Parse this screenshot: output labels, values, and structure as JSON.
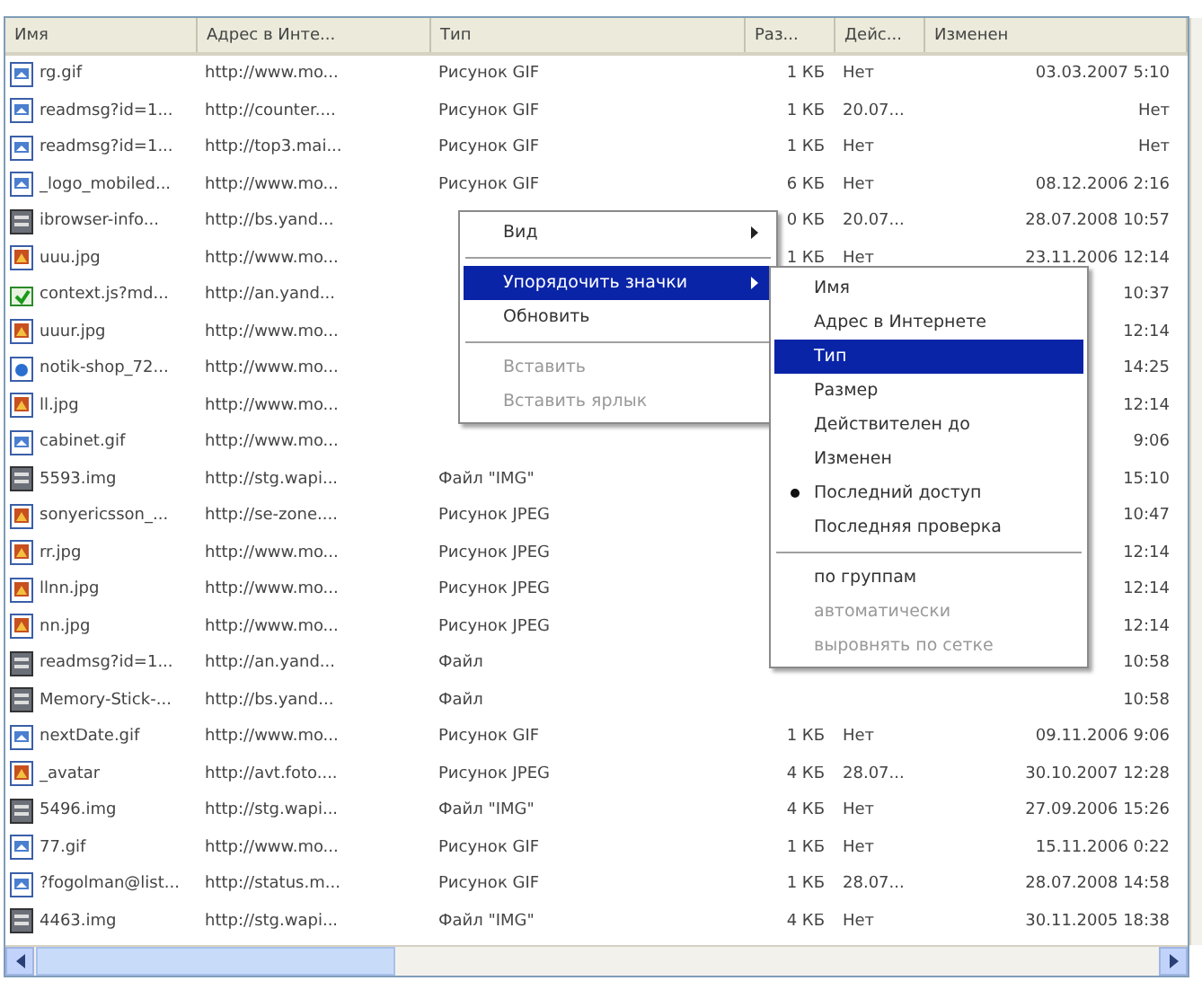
{
  "table": {
    "columns": [
      "Имя",
      "Адрес в Инте...",
      "Тип",
      "Раз...",
      "Дейс...",
      "Изменен"
    ],
    "rows": [
      {
        "kind": "gif",
        "name": "rg.gif",
        "address": "http://www.mo...",
        "type": "Рисунок GIF",
        "size": "1 КБ",
        "valid": "Нет",
        "modified": "03.03.2007 5:10"
      },
      {
        "kind": "gif",
        "name": "readmsg?id=1...",
        "address": "http://counter....",
        "type": "Рисунок GIF",
        "size": "1 КБ",
        "valid": "20.07...",
        "modified": "Нет"
      },
      {
        "kind": "gif",
        "name": "readmsg?id=1...",
        "address": "http://top3.mai...",
        "type": "Рисунок GIF",
        "size": "1 КБ",
        "valid": "Нет",
        "modified": "Нет"
      },
      {
        "kind": "gif",
        "name": "_logo_mobiled...",
        "address": "http://www.mo...",
        "type": "Рисунок GIF",
        "size": "6 КБ",
        "valid": "Нет",
        "modified": "08.12.2006 2:16"
      },
      {
        "kind": "file",
        "name": "ibrowser-info...",
        "address": "http://bs.yand...",
        "size": "0 КБ",
        "valid": "20.07...",
        "modified": "28.07.2008 10:57"
      },
      {
        "kind": "jpeg",
        "name": "uuu.jpg",
        "address": "http://www.mo...",
        "size": "1 КБ",
        "valid": "Нет",
        "modified": "23.11.2006 12:14"
      },
      {
        "kind": "script",
        "name": "context.js?md...",
        "address": "http://an.yand...",
        "modified": "10:37"
      },
      {
        "kind": "jpeg",
        "name": "uuur.jpg",
        "address": "http://www.mo...",
        "modified": "12:14"
      },
      {
        "kind": "page",
        "name": "notik-shop_72...",
        "address": "http://www.mo...",
        "modified": "14:25"
      },
      {
        "kind": "jpeg",
        "name": "ll.jpg",
        "address": "http://www.mo...",
        "modified": "12:14"
      },
      {
        "kind": "gif",
        "name": "cabinet.gif",
        "address": "http://www.mo...",
        "modified": "9:06"
      },
      {
        "kind": "file",
        "name": "5593.img",
        "address": "http://stg.wapi...",
        "type": "Файл \"IMG\"",
        "modified": "15:10"
      },
      {
        "kind": "jpeg",
        "name": "sonyericsson_...",
        "address": "http://se-zone....",
        "type": "Рисунок JPEG",
        "modified": "10:47"
      },
      {
        "kind": "jpeg",
        "name": "rr.jpg",
        "address": "http://www.mo...",
        "type": "Рисунок JPEG",
        "modified": "12:14"
      },
      {
        "kind": "jpeg",
        "name": "llnn.jpg",
        "address": "http://www.mo...",
        "type": "Рисунок JPEG",
        "modified": "12:14"
      },
      {
        "kind": "jpeg",
        "name": "nn.jpg",
        "address": "http://www.mo...",
        "type": "Рисунок JPEG",
        "modified": "12:14"
      },
      {
        "kind": "file",
        "name": "readmsg?id=1...",
        "address": "http://an.yand...",
        "type": "Файл",
        "modified": "10:58"
      },
      {
        "kind": "file",
        "name": "Memory-Stick-...",
        "address": "http://bs.yand...",
        "type": "Файл",
        "modified": "10:58"
      },
      {
        "kind": "gif",
        "name": "nextDate.gif",
        "address": "http://www.mo...",
        "type": "Рисунок GIF",
        "size": "1 КБ",
        "valid": "Нет",
        "modified": "09.11.2006 9:06"
      },
      {
        "kind": "jpeg",
        "name": "_avatar",
        "address": "http://avt.foto....",
        "type": "Рисунок JPEG",
        "size": "4 КБ",
        "valid": "28.07...",
        "modified": "30.10.2007 12:28"
      },
      {
        "kind": "file",
        "name": "5496.img",
        "address": "http://stg.wapi...",
        "type": "Файл \"IMG\"",
        "size": "4 КБ",
        "valid": "Нет",
        "modified": "27.09.2006 15:26"
      },
      {
        "kind": "gif",
        "name": "77.gif",
        "address": "http://www.mo...",
        "type": "Рисунок GIF",
        "size": "1 КБ",
        "valid": "Нет",
        "modified": "15.11.2006 0:22"
      },
      {
        "kind": "gif",
        "name": "?fogolman@list...",
        "address": "http://status.m...",
        "type": "Рисунок GIF",
        "size": "1 КБ",
        "valid": "28.07...",
        "modified": "28.07.2008 14:58"
      },
      {
        "kind": "file",
        "name": "4463.img",
        "address": "http://stg.wapi...",
        "type": "Файл \"IMG\"",
        "size": "4 КБ",
        "valid": "Нет",
        "modified": "30.11.2005 18:38"
      }
    ]
  },
  "context_menu": {
    "groups": [
      [
        {
          "label": "Вид",
          "submenu": true,
          "selected": false,
          "disabled": false
        }
      ],
      [
        {
          "label": "Упорядочить значки",
          "submenu": true,
          "selected": true,
          "disabled": false
        },
        {
          "label": "Обновить",
          "submenu": false,
          "selected": false,
          "disabled": false
        }
      ],
      [
        {
          "label": "Вставить",
          "submenu": false,
          "selected": false,
          "disabled": true
        },
        {
          "label": "Вставить ярлык",
          "submenu": false,
          "selected": false,
          "disabled": true
        }
      ]
    ]
  },
  "submenu": {
    "groups": [
      [
        {
          "label": "Имя",
          "selected": false,
          "checked": false,
          "disabled": false
        },
        {
          "label": "Адрес в Интернете",
          "selected": false,
          "checked": false,
          "disabled": false
        },
        {
          "label": "Тип",
          "selected": true,
          "checked": false,
          "disabled": false
        },
        {
          "label": "Размер",
          "selected": false,
          "checked": false,
          "disabled": false
        },
        {
          "label": "Действителен до",
          "selected": false,
          "checked": false,
          "disabled": false
        },
        {
          "label": "Изменен",
          "selected": false,
          "checked": false,
          "disabled": false
        },
        {
          "label": "Последний доступ",
          "selected": false,
          "checked": true,
          "disabled": false
        },
        {
          "label": "Последняя проверка",
          "selected": false,
          "checked": false,
          "disabled": false
        }
      ],
      [
        {
          "label": "по группам",
          "selected": false,
          "checked": false,
          "disabled": false
        },
        {
          "label": "автоматически",
          "selected": false,
          "checked": false,
          "disabled": true
        },
        {
          "label": "выровнять по сетке",
          "selected": false,
          "checked": false,
          "disabled": true
        }
      ]
    ]
  }
}
